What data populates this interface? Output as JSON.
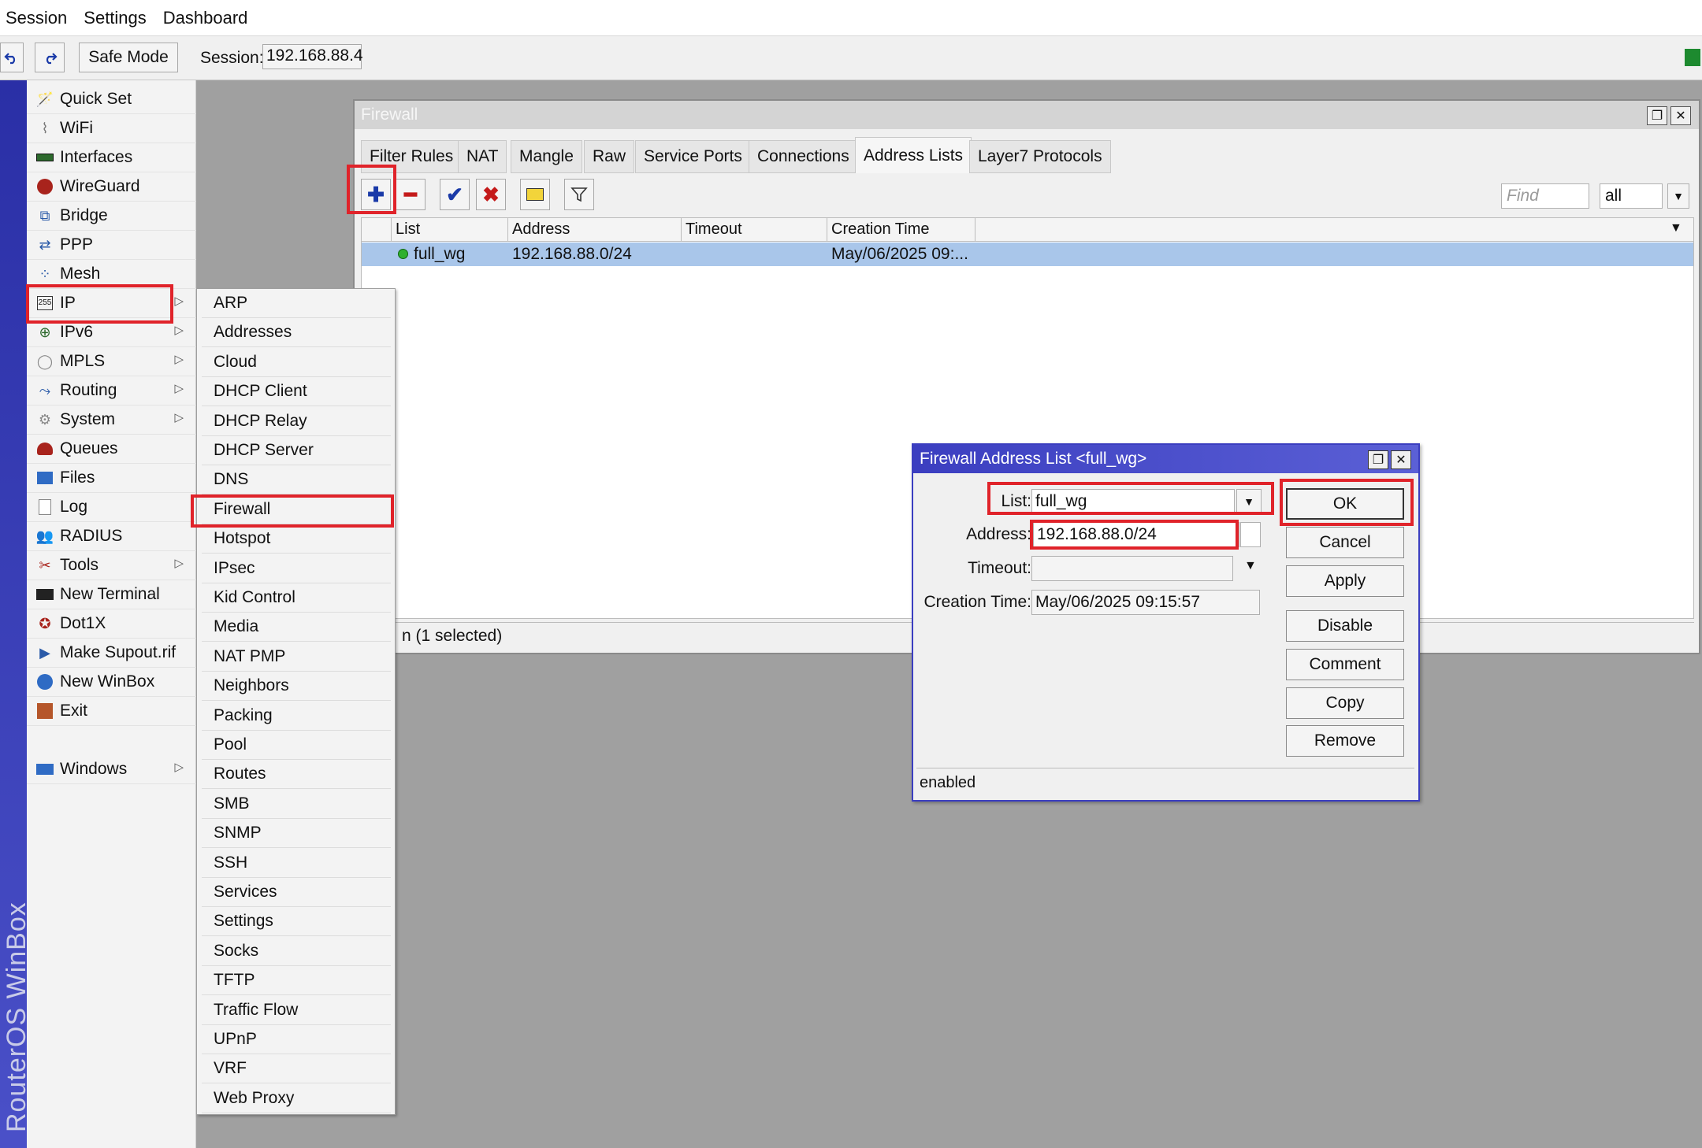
{
  "menubar": {
    "items": [
      "Session",
      "Settings",
      "Dashboard"
    ]
  },
  "toolbar": {
    "undo_icon": "undo-icon",
    "redo_icon": "redo-icon",
    "safe_mode": "Safe Mode",
    "session_label": "Session:",
    "session_value": "192.168.88.4"
  },
  "brand": {
    "text": "RouterOS WinBox"
  },
  "nav": {
    "items": [
      {
        "label": "Quick Set",
        "icon": "wand-icon",
        "has_sub": false
      },
      {
        "label": "WiFi",
        "icon": "wifi-icon",
        "has_sub": false
      },
      {
        "label": "Interfaces",
        "icon": "interfaces-icon",
        "has_sub": false
      },
      {
        "label": "WireGuard",
        "icon": "wireguard-icon",
        "has_sub": false
      },
      {
        "label": "Bridge",
        "icon": "bridge-icon",
        "has_sub": false
      },
      {
        "label": "PPP",
        "icon": "ppp-icon",
        "has_sub": false
      },
      {
        "label": "Mesh",
        "icon": "mesh-icon",
        "has_sub": false
      },
      {
        "label": "IP",
        "icon": "ip-icon",
        "has_sub": true
      },
      {
        "label": "IPv6",
        "icon": "ipv6-icon",
        "has_sub": true
      },
      {
        "label": "MPLS",
        "icon": "mpls-icon",
        "has_sub": true
      },
      {
        "label": "Routing",
        "icon": "routing-icon",
        "has_sub": true
      },
      {
        "label": "System",
        "icon": "gear-icon",
        "has_sub": true
      },
      {
        "label": "Queues",
        "icon": "queues-icon",
        "has_sub": false
      },
      {
        "label": "Files",
        "icon": "folder-icon",
        "has_sub": false
      },
      {
        "label": "Log",
        "icon": "log-icon",
        "has_sub": false
      },
      {
        "label": "RADIUS",
        "icon": "radius-icon",
        "has_sub": false
      },
      {
        "label": "Tools",
        "icon": "tools-icon",
        "has_sub": true
      },
      {
        "label": "New Terminal",
        "icon": "terminal-icon",
        "has_sub": false
      },
      {
        "label": "Dot1X",
        "icon": "dot1x-icon",
        "has_sub": false
      },
      {
        "label": "Make Supout.rif",
        "icon": "supout-icon",
        "has_sub": false
      },
      {
        "label": "New WinBox",
        "icon": "winbox-icon",
        "has_sub": false
      },
      {
        "label": "Exit",
        "icon": "exit-icon",
        "has_sub": false
      },
      {
        "label": "Windows",
        "icon": "windows-icon",
        "has_sub": true
      }
    ]
  },
  "ip_submenu": {
    "items": [
      "ARP",
      "Addresses",
      "Cloud",
      "DHCP Client",
      "DHCP Relay",
      "DHCP Server",
      "DNS",
      "Firewall",
      "Hotspot",
      "IPsec",
      "Kid Control",
      "Media",
      "NAT PMP",
      "Neighbors",
      "Packing",
      "Pool",
      "Routes",
      "SMB",
      "SNMP",
      "SSH",
      "Services",
      "Settings",
      "Socks",
      "TFTP",
      "Traffic Flow",
      "UPnP",
      "VRF",
      "Web Proxy"
    ],
    "highlighted": "Firewall"
  },
  "firewall": {
    "title": "Firewall",
    "tabs": [
      "Filter Rules",
      "NAT",
      "Mangle",
      "Raw",
      "Service Ports",
      "Connections",
      "Address Lists",
      "Layer7 Protocols"
    ],
    "active_tab": "Address Lists",
    "find_placeholder": "Find",
    "filter_value": "all",
    "columns": [
      "List",
      "Address",
      "Timeout",
      "Creation Time"
    ],
    "rows": [
      {
        "list": "full_wg",
        "address": "192.168.88.0/24",
        "timeout": "",
        "creation_time": "May/06/2025 09:...",
        "enabled": true
      }
    ],
    "status": "n (1 selected)"
  },
  "dialog": {
    "title": "Firewall Address List <full_wg>",
    "fields": {
      "list_label": "List:",
      "list_value": "full_wg",
      "address_label": "Address:",
      "address_value": "192.168.88.0/24",
      "timeout_label": "Timeout:",
      "timeout_value": "",
      "creation_label": "Creation Time:",
      "creation_value": "May/06/2025 09:15:57"
    },
    "buttons": [
      "OK",
      "Cancel",
      "Apply",
      "Disable",
      "Comment",
      "Copy",
      "Remove"
    ],
    "status": "enabled"
  },
  "colors": {
    "highlight": "#e0232a",
    "selected_row": "#a9c6ea",
    "dialog_title": "#3b3ec0",
    "brand_bar": "#2a2fa6"
  }
}
